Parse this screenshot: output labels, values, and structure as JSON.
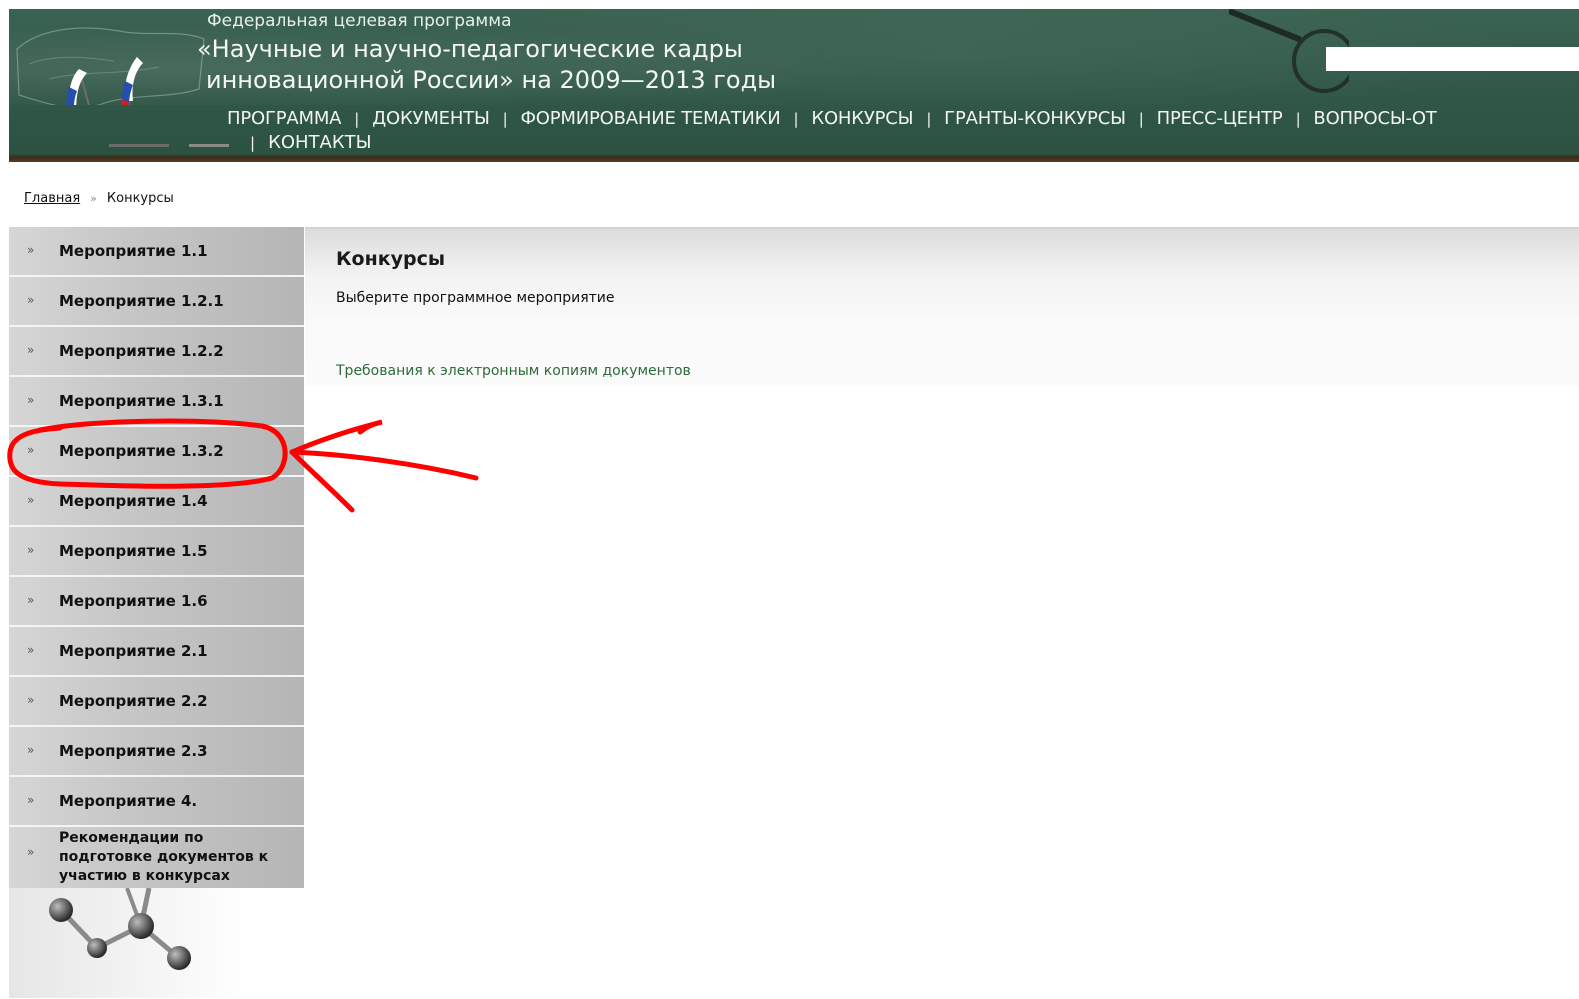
{
  "header": {
    "subtitle": "Федеральная целевая программа",
    "title_line1": "«Научные и научно-педагогические кадры",
    "title_line2": "инновационной России» на 2009—2013 годы",
    "search": {
      "value": "",
      "placeholder": ""
    }
  },
  "nav": {
    "separator": "|",
    "items": [
      "ПРОГРАММА",
      "ДОКУМЕНТЫ",
      "ФОРМИРОВАНИЕ ТЕМАТИКИ",
      "КОНКУРСЫ",
      "ГРАНТЫ-КОНКУРСЫ",
      "ПРЕСС-ЦЕНТР",
      "ВОПРОСЫ-ОТ",
      "КОНТАКТЫ"
    ]
  },
  "breadcrumb": {
    "home": "Главная",
    "separator": "»",
    "current": "Конкурсы"
  },
  "sidebar": {
    "arrow": "»",
    "items": [
      "Мероприятие 1.1",
      "Мероприятие 1.2.1",
      "Мероприятие 1.2.2",
      "Мероприятие 1.3.1",
      "Мероприятие 1.3.2",
      "Мероприятие 1.4",
      "Мероприятие 1.5",
      "Мероприятие 1.6",
      "Мероприятие 2.1",
      "Мероприятие 2.2",
      "Мероприятие 2.3",
      "Мероприятие 4.",
      "Рекомендации по подготовке документов к участию в конкурсах"
    ]
  },
  "content": {
    "title": "Конкурсы",
    "subtitle": "Выберите программное мероприятие",
    "link": "Требования к электронным копиям документов"
  },
  "annotation": {
    "color": "#ff0000",
    "highlighted_item": "Мероприятие 1.3.2"
  },
  "colors": {
    "header_green": "#33594a",
    "link_green": "#2e6b3a"
  }
}
